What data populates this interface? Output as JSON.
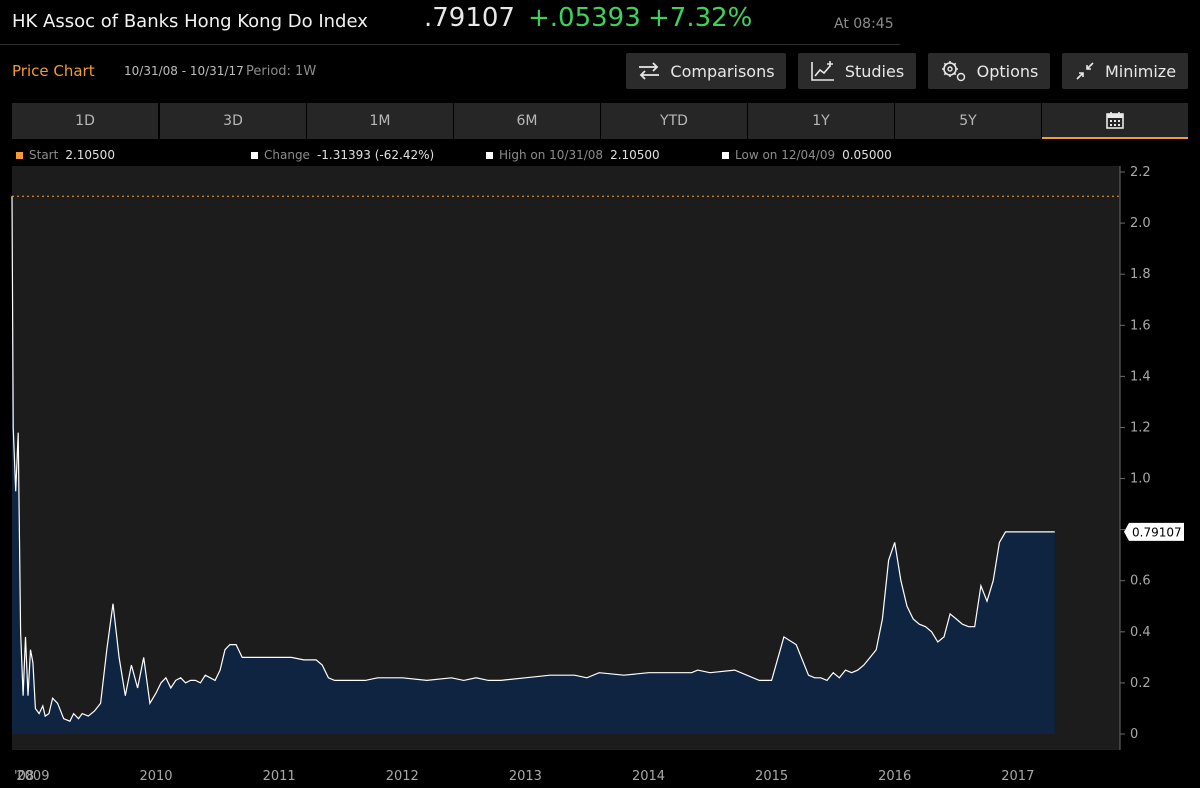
{
  "header": {
    "title": "HK Assoc of Banks Hong Kong Do Index",
    "last_price": ".79107",
    "net_change": "+.05393",
    "pct_change": "+7.32%",
    "time": "At 08:45"
  },
  "subbar": {
    "section_title": "Price Chart",
    "date_range": "10/31/08 - 10/31/17",
    "period": "Period: 1W",
    "buttons": {
      "comparisons": "Comparisons",
      "studies": "Studies",
      "options": "Options",
      "minimize": "Minimize"
    }
  },
  "tabs": [
    "1D",
    "3D",
    "1M",
    "6M",
    "YTD",
    "1Y",
    "5Y"
  ],
  "stats": {
    "start_label": "Start",
    "start_value": "2.10500",
    "change_label": "Change",
    "change_value": "-1.31393 (-62.42%)",
    "high_label": "High on 10/31/08",
    "high_value": "2.10500",
    "low_label": "Low on 12/04/09",
    "low_value": "0.05000"
  },
  "colors": {
    "accent": "#f39c32",
    "up": "#3fd25a",
    "area_fill": "#0e2440",
    "line": "#ffffff",
    "plot_bg": "#1c1c1c"
  },
  "chart_data": {
    "type": "area",
    "ylim": [
      0,
      2.2
    ],
    "yticks": [
      0,
      0.2,
      0.4,
      0.6,
      0.8,
      1.0,
      1.2,
      1.4,
      1.6,
      1.8,
      2.0,
      2.2
    ],
    "ytick_labels": [
      "0",
      "0.2",
      "0.4",
      "0.6",
      "0.8",
      "1.0",
      "1.2",
      "1.4",
      "1.6",
      "1.8",
      "2.0",
      "2.2"
    ],
    "xlim": [
      2008.83,
      2017.83
    ],
    "xticks": [
      2008.83,
      2009.0,
      2010.0,
      2011.0,
      2012.0,
      2013.0,
      2014.0,
      2015.0,
      2016.0,
      2017.0
    ],
    "xtick_labels": [
      "'08",
      "2009",
      "2010",
      "2011",
      "2012",
      "2013",
      "2014",
      "2015",
      "2016",
      "2017"
    ],
    "start_reference": 2.105,
    "last_value_label": "0.79107",
    "series": [
      {
        "x": [
          2008.83,
          2008.84,
          2008.86,
          2008.88,
          2008.9,
          2008.92,
          2008.94,
          2008.96,
          2008.98,
          2009.0,
          2009.02,
          2009.05,
          2009.08,
          2009.1,
          2009.13,
          2009.16,
          2009.2,
          2009.25,
          2009.3,
          2009.33,
          2009.37,
          2009.4,
          2009.45,
          2009.5,
          2009.55,
          2009.6,
          2009.65,
          2009.7,
          2009.75,
          2009.8,
          2009.85,
          2009.9,
          2009.95,
          2010.0,
          2010.04,
          2010.08,
          2010.12,
          2010.16,
          2010.2,
          2010.24,
          2010.28,
          2010.32,
          2010.36,
          2010.4,
          2010.44,
          2010.48,
          2010.52,
          2010.56,
          2010.6,
          2010.65,
          2010.7,
          2010.8,
          2010.9,
          2011.0,
          2011.1,
          2011.2,
          2011.3,
          2011.35,
          2011.4,
          2011.45,
          2011.5,
          2011.55,
          2011.6,
          2011.65,
          2011.7,
          2011.8,
          2012.0,
          2012.2,
          2012.4,
          2012.5,
          2012.6,
          2012.7,
          2012.8,
          2013.0,
          2013.2,
          2013.4,
          2013.5,
          2013.6,
          2013.8,
          2014.0,
          2014.1,
          2014.2,
          2014.3,
          2014.35,
          2014.4,
          2014.5,
          2014.7,
          2014.9,
          2015.0,
          2015.1,
          2015.2,
          2015.3,
          2015.35,
          2015.4,
          2015.45,
          2015.5,
          2015.55,
          2015.6,
          2015.65,
          2015.7,
          2015.75,
          2015.8,
          2015.85,
          2015.9,
          2015.95,
          2016.0,
          2016.05,
          2016.1,
          2016.15,
          2016.2,
          2016.25,
          2016.3,
          2016.35,
          2016.4,
          2016.45,
          2016.5,
          2016.55,
          2016.6,
          2016.65,
          2016.7,
          2016.75,
          2016.8,
          2016.85,
          2016.9,
          2016.95,
          2017.0,
          2017.05,
          2017.1,
          2017.15,
          2017.2,
          2017.25,
          2017.3
        ],
        "y": [
          2.105,
          1.2,
          0.95,
          1.18,
          0.4,
          0.15,
          0.38,
          0.15,
          0.33,
          0.28,
          0.1,
          0.08,
          0.11,
          0.07,
          0.08,
          0.14,
          0.12,
          0.06,
          0.05,
          0.08,
          0.06,
          0.08,
          0.07,
          0.09,
          0.12,
          0.33,
          0.51,
          0.3,
          0.15,
          0.27,
          0.18,
          0.3,
          0.12,
          0.16,
          0.2,
          0.22,
          0.18,
          0.21,
          0.22,
          0.2,
          0.21,
          0.21,
          0.2,
          0.23,
          0.22,
          0.21,
          0.25,
          0.33,
          0.35,
          0.35,
          0.3,
          0.3,
          0.3,
          0.3,
          0.3,
          0.29,
          0.29,
          0.27,
          0.22,
          0.21,
          0.21,
          0.21,
          0.21,
          0.21,
          0.21,
          0.22,
          0.22,
          0.21,
          0.22,
          0.21,
          0.22,
          0.21,
          0.21,
          0.22,
          0.23,
          0.23,
          0.22,
          0.24,
          0.23,
          0.24,
          0.24,
          0.24,
          0.24,
          0.24,
          0.25,
          0.24,
          0.25,
          0.21,
          0.21,
          0.38,
          0.35,
          0.23,
          0.22,
          0.22,
          0.21,
          0.24,
          0.22,
          0.25,
          0.24,
          0.25,
          0.27,
          0.3,
          0.33,
          0.45,
          0.68,
          0.75,
          0.6,
          0.5,
          0.45,
          0.43,
          0.42,
          0.4,
          0.36,
          0.38,
          0.47,
          0.45,
          0.43,
          0.42,
          0.42,
          0.58,
          0.52,
          0.6,
          0.75,
          0.79107,
          0.79107,
          0.79107,
          0.79107,
          0.79107,
          0.79107,
          0.79107,
          0.79107,
          0.79107
        ]
      }
    ]
  }
}
